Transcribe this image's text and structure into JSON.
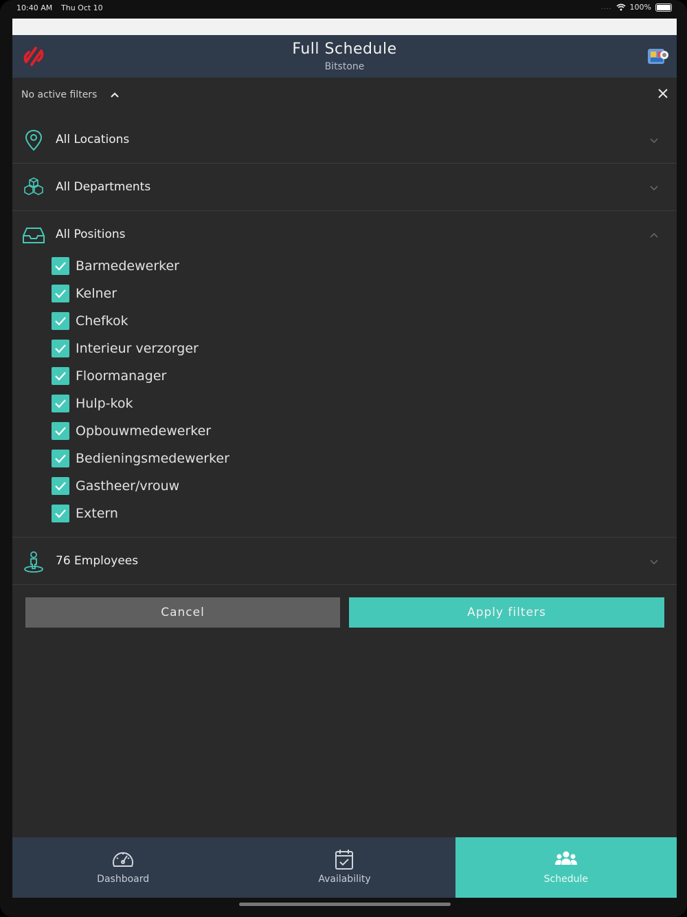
{
  "status_bar": {
    "time": "10:40 AM",
    "date": "Thu Oct 10",
    "battery": "100%"
  },
  "header": {
    "title": "Full Schedule",
    "subtitle": "Bitstone",
    "logo_icon": "brand-logo-icon",
    "profile_icon": "profile-icon"
  },
  "filters": {
    "status_label": "No active filters",
    "sections": {
      "locations": {
        "label": "All Locations",
        "icon": "location-pin-icon",
        "expanded": false
      },
      "departments": {
        "label": "All Departments",
        "icon": "boxes-icon",
        "expanded": false
      },
      "positions": {
        "label": "All Positions",
        "icon": "inbox-tray-icon",
        "expanded": true
      },
      "employees": {
        "label": "76 Employees",
        "icon": "person-icon",
        "expanded": false
      }
    },
    "positions": [
      {
        "label": "Barmedewerker",
        "checked": true
      },
      {
        "label": "Kelner",
        "checked": true
      },
      {
        "label": "Chefkok",
        "checked": true
      },
      {
        "label": "Interieur verzorger",
        "checked": true
      },
      {
        "label": "Floormanager",
        "checked": true
      },
      {
        "label": "Hulp-kok",
        "checked": true
      },
      {
        "label": "Opbouwmedewerker",
        "checked": true
      },
      {
        "label": "Bedieningsmedewerker",
        "checked": true
      },
      {
        "label": "Gastheer/vrouw",
        "checked": true
      },
      {
        "label": "Extern",
        "checked": true
      }
    ],
    "cancel_label": "Cancel",
    "apply_label": "Apply filters"
  },
  "tabs": [
    {
      "label": "Dashboard",
      "icon": "gauge-icon",
      "active": false
    },
    {
      "label": "Availability",
      "icon": "calendar-check-icon",
      "active": false
    },
    {
      "label": "Schedule",
      "icon": "group-icon",
      "active": true
    }
  ],
  "colors": {
    "accent": "#46c8b8",
    "header_bg": "#2f3a4a",
    "panel_bg": "#2a2a2a",
    "brand_red": "#e0202a"
  }
}
